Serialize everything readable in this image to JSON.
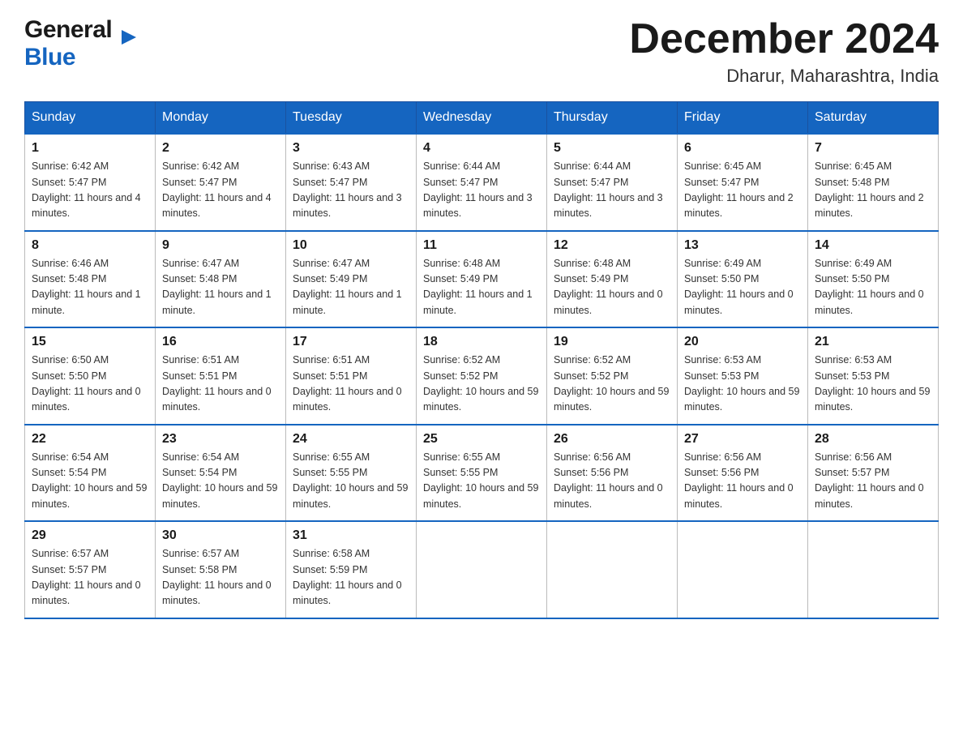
{
  "header": {
    "logo_general": "General",
    "logo_blue": "Blue",
    "month_title": "December 2024",
    "location": "Dharur, Maharashtra, India"
  },
  "days_of_week": [
    "Sunday",
    "Monday",
    "Tuesday",
    "Wednesday",
    "Thursday",
    "Friday",
    "Saturday"
  ],
  "weeks": [
    [
      {
        "num": "1",
        "sunrise": "6:42 AM",
        "sunset": "5:47 PM",
        "daylight": "11 hours and 4 minutes."
      },
      {
        "num": "2",
        "sunrise": "6:42 AM",
        "sunset": "5:47 PM",
        "daylight": "11 hours and 4 minutes."
      },
      {
        "num": "3",
        "sunrise": "6:43 AM",
        "sunset": "5:47 PM",
        "daylight": "11 hours and 3 minutes."
      },
      {
        "num": "4",
        "sunrise": "6:44 AM",
        "sunset": "5:47 PM",
        "daylight": "11 hours and 3 minutes."
      },
      {
        "num": "5",
        "sunrise": "6:44 AM",
        "sunset": "5:47 PM",
        "daylight": "11 hours and 3 minutes."
      },
      {
        "num": "6",
        "sunrise": "6:45 AM",
        "sunset": "5:47 PM",
        "daylight": "11 hours and 2 minutes."
      },
      {
        "num": "7",
        "sunrise": "6:45 AM",
        "sunset": "5:48 PM",
        "daylight": "11 hours and 2 minutes."
      }
    ],
    [
      {
        "num": "8",
        "sunrise": "6:46 AM",
        "sunset": "5:48 PM",
        "daylight": "11 hours and 1 minute."
      },
      {
        "num": "9",
        "sunrise": "6:47 AM",
        "sunset": "5:48 PM",
        "daylight": "11 hours and 1 minute."
      },
      {
        "num": "10",
        "sunrise": "6:47 AM",
        "sunset": "5:49 PM",
        "daylight": "11 hours and 1 minute."
      },
      {
        "num": "11",
        "sunrise": "6:48 AM",
        "sunset": "5:49 PM",
        "daylight": "11 hours and 1 minute."
      },
      {
        "num": "12",
        "sunrise": "6:48 AM",
        "sunset": "5:49 PM",
        "daylight": "11 hours and 0 minutes."
      },
      {
        "num": "13",
        "sunrise": "6:49 AM",
        "sunset": "5:50 PM",
        "daylight": "11 hours and 0 minutes."
      },
      {
        "num": "14",
        "sunrise": "6:49 AM",
        "sunset": "5:50 PM",
        "daylight": "11 hours and 0 minutes."
      }
    ],
    [
      {
        "num": "15",
        "sunrise": "6:50 AM",
        "sunset": "5:50 PM",
        "daylight": "11 hours and 0 minutes."
      },
      {
        "num": "16",
        "sunrise": "6:51 AM",
        "sunset": "5:51 PM",
        "daylight": "11 hours and 0 minutes."
      },
      {
        "num": "17",
        "sunrise": "6:51 AM",
        "sunset": "5:51 PM",
        "daylight": "11 hours and 0 minutes."
      },
      {
        "num": "18",
        "sunrise": "6:52 AM",
        "sunset": "5:52 PM",
        "daylight": "10 hours and 59 minutes."
      },
      {
        "num": "19",
        "sunrise": "6:52 AM",
        "sunset": "5:52 PM",
        "daylight": "10 hours and 59 minutes."
      },
      {
        "num": "20",
        "sunrise": "6:53 AM",
        "sunset": "5:53 PM",
        "daylight": "10 hours and 59 minutes."
      },
      {
        "num": "21",
        "sunrise": "6:53 AM",
        "sunset": "5:53 PM",
        "daylight": "10 hours and 59 minutes."
      }
    ],
    [
      {
        "num": "22",
        "sunrise": "6:54 AM",
        "sunset": "5:54 PM",
        "daylight": "10 hours and 59 minutes."
      },
      {
        "num": "23",
        "sunrise": "6:54 AM",
        "sunset": "5:54 PM",
        "daylight": "10 hours and 59 minutes."
      },
      {
        "num": "24",
        "sunrise": "6:55 AM",
        "sunset": "5:55 PM",
        "daylight": "10 hours and 59 minutes."
      },
      {
        "num": "25",
        "sunrise": "6:55 AM",
        "sunset": "5:55 PM",
        "daylight": "10 hours and 59 minutes."
      },
      {
        "num": "26",
        "sunrise": "6:56 AM",
        "sunset": "5:56 PM",
        "daylight": "11 hours and 0 minutes."
      },
      {
        "num": "27",
        "sunrise": "6:56 AM",
        "sunset": "5:56 PM",
        "daylight": "11 hours and 0 minutes."
      },
      {
        "num": "28",
        "sunrise": "6:56 AM",
        "sunset": "5:57 PM",
        "daylight": "11 hours and 0 minutes."
      }
    ],
    [
      {
        "num": "29",
        "sunrise": "6:57 AM",
        "sunset": "5:57 PM",
        "daylight": "11 hours and 0 minutes."
      },
      {
        "num": "30",
        "sunrise": "6:57 AM",
        "sunset": "5:58 PM",
        "daylight": "11 hours and 0 minutes."
      },
      {
        "num": "31",
        "sunrise": "6:58 AM",
        "sunset": "5:59 PM",
        "daylight": "11 hours and 0 minutes."
      },
      null,
      null,
      null,
      null
    ]
  ],
  "labels": {
    "sunrise_prefix": "Sunrise: ",
    "sunset_prefix": "Sunset: ",
    "daylight_prefix": "Daylight: "
  }
}
